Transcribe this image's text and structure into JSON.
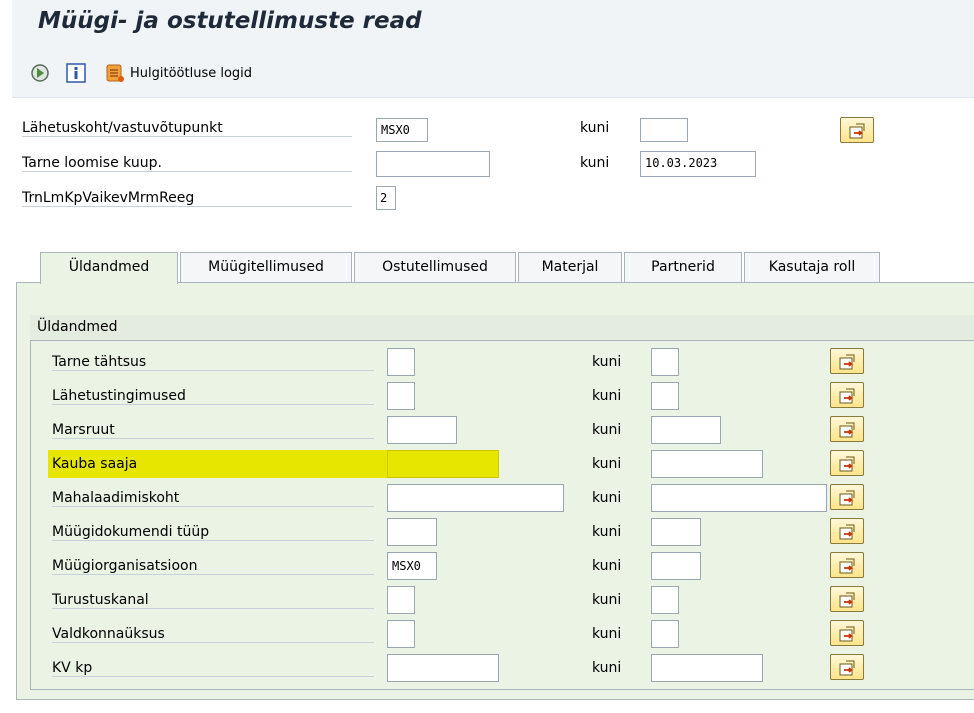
{
  "header": {
    "title": "Müügi- ja ostutellimuste read"
  },
  "toolbar": {
    "execute_icon": "execute-icon",
    "info_icon": "info-icon",
    "log_icon": "log-icon",
    "log_label": "Hulgitöötluse logid"
  },
  "top_fields": [
    {
      "label": "Lähetuskoht/vastuvõtupunkt",
      "value": "MSX0",
      "to_label": "kuni",
      "to_value": ""
    },
    {
      "label": "Tarne loomise kuup.",
      "value": "",
      "to_label": "kuni",
      "to_value": "10.03.2023"
    },
    {
      "label": "TrnLmKpVaikevMrmReeg",
      "value": "2"
    }
  ],
  "tabs": [
    "Üldandmed",
    "Müügitellimused",
    "Ostutellimused",
    "Materjal",
    "Partnerid",
    "Kasutaja roll"
  ],
  "active_tab": "Üldandmed",
  "group": {
    "title": "Üldandmed",
    "rows": [
      {
        "label": "Tarne tähtsus",
        "value": "",
        "to_label": "kuni",
        "to_value": ""
      },
      {
        "label": "Lähetustingimused",
        "value": "",
        "to_label": "kuni",
        "to_value": ""
      },
      {
        "label": "Marsruut",
        "value": "",
        "to_label": "kuni",
        "to_value": ""
      },
      {
        "label": "Kauba saaja",
        "value": "",
        "to_label": "kuni",
        "to_value": "",
        "highlighted": true
      },
      {
        "label": "Mahalaadimiskoht",
        "value": "",
        "to_label": "kuni",
        "to_value": ""
      },
      {
        "label": "Müügidokumendi tüüp",
        "value": "",
        "to_label": "kuni",
        "to_value": ""
      },
      {
        "label": "Müügiorganisatsioon",
        "value": "MSX0",
        "to_label": "kuni",
        "to_value": ""
      },
      {
        "label": "Turustuskanal",
        "value": "",
        "to_label": "kuni",
        "to_value": ""
      },
      {
        "label": "Valdkonnaüksus",
        "value": "",
        "to_label": "kuni",
        "to_value": ""
      },
      {
        "label": "KV kp",
        "value": "",
        "to_label": "kuni",
        "to_value": ""
      }
    ]
  },
  "colors": {
    "highlight": "#e6e600",
    "panel": "#eaf3e4",
    "title_bar": "#f0f4f6"
  },
  "icons": {
    "multiple_selection": "multiple-selection-icon"
  }
}
